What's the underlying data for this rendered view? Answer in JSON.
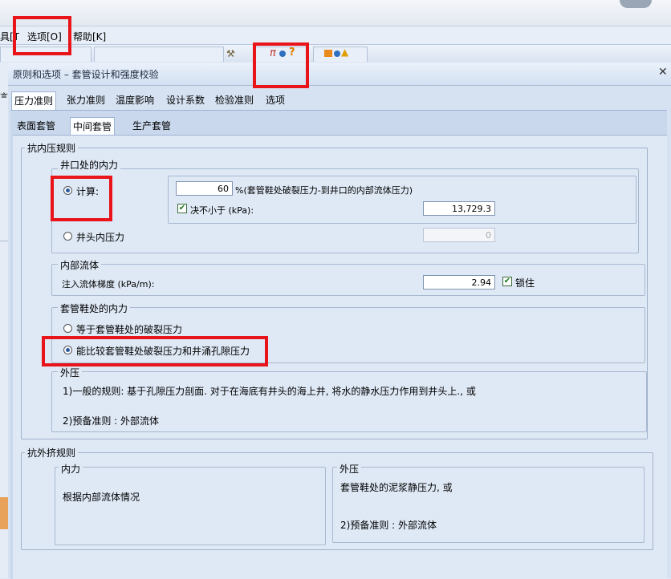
{
  "menu": {
    "partial_left": "具[T",
    "options": "选项[O]",
    "help": "帮助[K]"
  },
  "dialog": {
    "title": "原则和选项 – 套管设计和强度校验",
    "close_icon": "close-icon"
  },
  "tabs": [
    "压力准则",
    "张力准则",
    "温度影响",
    "设计系数",
    "检验准则",
    "选项"
  ],
  "subtabs": [
    "表面套管",
    "中间套管",
    "生产套管"
  ],
  "burst": {
    "legend": "抗内压规则",
    "wellhead": {
      "legend": "井口处的内力",
      "calc_label": "计算:",
      "percent_value": "60",
      "percent_desc": "%(套管鞋处破裂压力-到井口的内部流体压力)",
      "notless_label": "决不小于 (kPa):",
      "notless_value": "13,729.3",
      "wellhead_pressure_label": "井头内压力",
      "wellhead_pressure_value": "0"
    },
    "internal_fluid": {
      "legend": "内部流体",
      "gradient_label": "注入流体梯度 (kPa/m):",
      "gradient_value": "2.94",
      "lock_label": "锁住"
    },
    "shoe": {
      "legend": "套管鞋处的内力",
      "option1": "等于套管鞋处的破裂压力",
      "option2": "能比较套管鞋处破裂压力和井涌孔隙压力"
    },
    "external": {
      "legend": "外压",
      "line1": "1)一般的规则: 基于孔隙压力剖面. 对于在海底有井头的海上井, 将水的静水压力作用到井头上., 或",
      "line2": "2)预备准则 : 外部流体"
    }
  },
  "collapse": {
    "legend": "抗外挤规则",
    "internal": {
      "legend": "内力",
      "text": "根据内部流体情况"
    },
    "external": {
      "legend": "外压",
      "line1": "套管鞋处的泥浆静压力, 或",
      "line2": "2)预备准则 : 外部流体"
    }
  },
  "colors": {
    "highlight_red": "#e8141a",
    "panel_bg": "#dfe9f6",
    "accent_blue": "#2a5aa0"
  }
}
